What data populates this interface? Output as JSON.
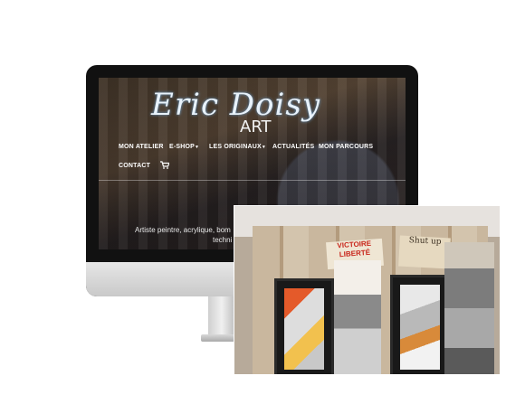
{
  "site": {
    "logo_script": "Eric Doisy",
    "logo_sub": "ART"
  },
  "nav": {
    "items": [
      {
        "label": "MON ATELIER"
      },
      {
        "label": "E-SHOP"
      },
      {
        "label": "LES ORIGINAUX"
      },
      {
        "label": "ACTUALITÉS"
      },
      {
        "label": "MON PARCOURS"
      },
      {
        "label": "CONTACT"
      }
    ],
    "cart_icon": "cart-icon"
  },
  "hero": {
    "tagline_line1": "Artiste peintre, acrylique, bom",
    "tagline_line2": "techni"
  },
  "photo": {
    "sign_text_1": "VICTOIRE",
    "sign_text_2": "LIBERTÉ",
    "sign2_text": "Shut up"
  },
  "colors": {
    "screen_bg": "#111111",
    "nav_text": "#ffffff",
    "logo": "#e8f2fb"
  }
}
